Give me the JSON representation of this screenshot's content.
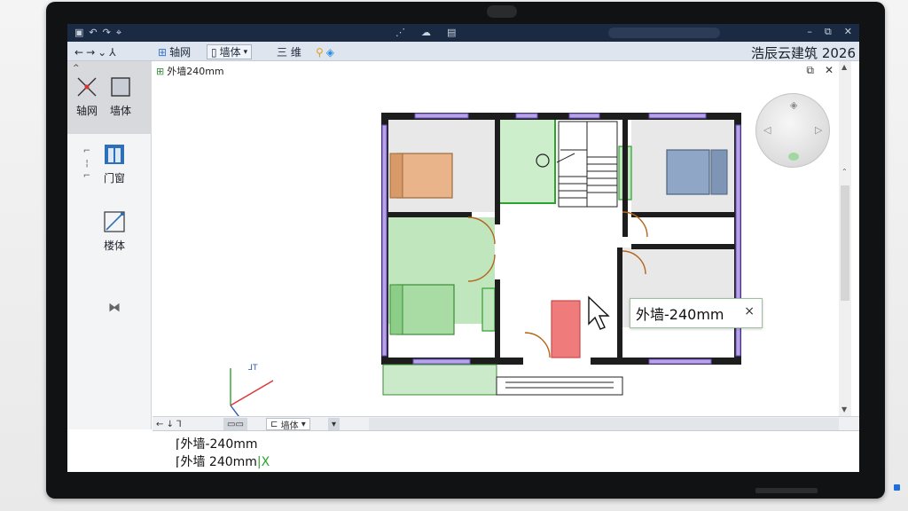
{
  "app": {
    "name": "浩辰云建筑 2026",
    "document_tab": "外墙240mm"
  },
  "ribbon": {
    "tabs": [
      {
        "label": "轴网",
        "icon": "grid-axis-icon"
      },
      {
        "label": "墙体",
        "icon": "wall-icon"
      }
    ],
    "extra_label": "三 维"
  },
  "left_panel": {
    "tools": [
      {
        "label": "轴网",
        "icon": "axis-tool-icon"
      },
      {
        "label": "墙体",
        "icon": "wall-tool-icon"
      },
      {
        "label": "门窗",
        "icon": "door-window-icon"
      },
      {
        "label": "楼体",
        "icon": "stair-tool-icon"
      }
    ]
  },
  "tooltip": {
    "text": "外墙-240mm",
    "close": "×"
  },
  "statusbar": {
    "layer": "墙体"
  },
  "command_line": {
    "lines": [
      "外墙-240mm",
      "外墙 240mm"
    ]
  },
  "colors": {
    "titlebar": "#1b2a43",
    "ribbon": "#dfe5ee",
    "room_orange": "#e9b48a",
    "room_green": "#a9dca5",
    "room_blue": "#8fa6c6",
    "door_red": "#ef7b7b",
    "window_purple": "#8b6fd1"
  }
}
